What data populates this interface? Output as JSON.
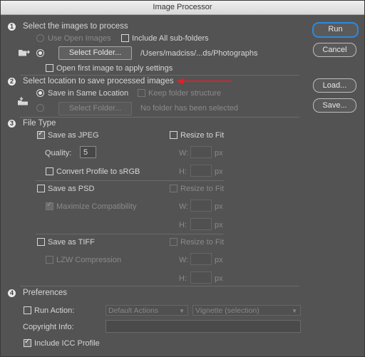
{
  "window": {
    "title": "Image Processor"
  },
  "buttons": {
    "run": "Run",
    "cancel": "Cancel",
    "load": "Load...",
    "save": "Save..."
  },
  "section1": {
    "number": "1",
    "title": "Select the images to process",
    "use_open_images": "Use Open Images",
    "include_subfolders": "Include All sub-folders",
    "select_folder": "Select Folder...",
    "folder_path": "/Users/madciss/...ds/Photographs",
    "open_first_image": "Open first image to apply settings"
  },
  "section2": {
    "number": "2",
    "title": "Select location to save processed images",
    "save_same_location": "Save in Same Location",
    "keep_folder_structure": "Keep folder structure",
    "select_folder": "Select Folder...",
    "no_folder": "No folder has been selected",
    "arrow_color": "#e0202a"
  },
  "section3": {
    "number": "3",
    "title": "File Type",
    "jpeg": {
      "label": "Save as JPEG",
      "resize": "Resize to Fit",
      "quality_label": "Quality:",
      "quality_value": "5",
      "convert_profile": "Convert Profile to sRGB",
      "w": "W:",
      "h": "H:",
      "unit": "px"
    },
    "psd": {
      "label": "Save as PSD",
      "resize": "Resize to Fit",
      "maximize": "Maximize Compatibility",
      "w": "W:",
      "h": "H:",
      "unit": "px"
    },
    "tiff": {
      "label": "Save as TIFF",
      "resize": "Resize to Fit",
      "lzw": "LZW Compression",
      "w": "W:",
      "h": "H:",
      "unit": "px"
    }
  },
  "section4": {
    "number": "4",
    "title": "Preferences",
    "run_action": "Run Action:",
    "action_set": "Default Actions",
    "action": "Vignette (selection)",
    "copyright_label": "Copyright Info:",
    "copyright_value": "",
    "include_icc": "Include ICC Profile"
  }
}
